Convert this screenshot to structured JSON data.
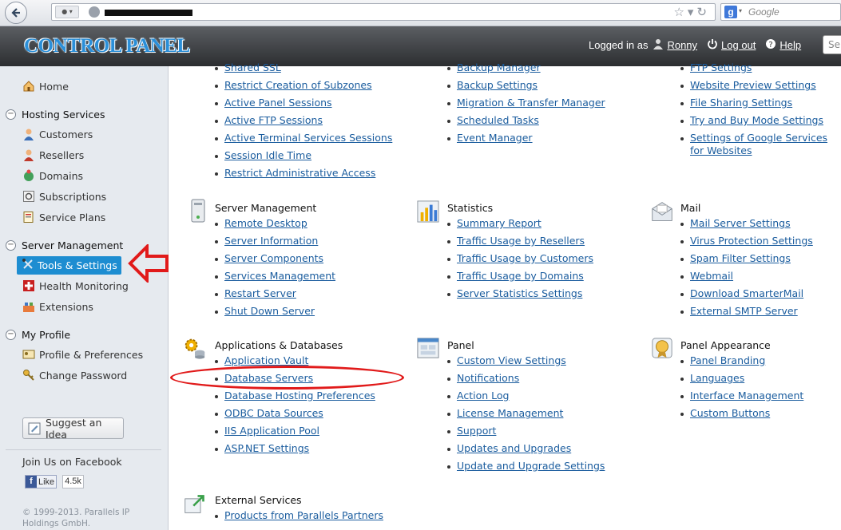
{
  "browser": {
    "search_placeholder": "Google"
  },
  "header": {
    "brand": "CONTROL PANEL",
    "logged_in_as": "Logged in as",
    "user": "Ronny",
    "logout": "Log out",
    "help": "Help",
    "search_placeholder": "Se"
  },
  "sidebar": {
    "home": "Home",
    "hosting_services": "Hosting Services",
    "hosting_items": [
      "Customers",
      "Resellers",
      "Domains",
      "Subscriptions",
      "Service Plans"
    ],
    "server_management": "Server Management",
    "tools_settings": "Tools & Settings",
    "server_items": [
      "Health Monitoring",
      "Extensions"
    ],
    "my_profile": "My Profile",
    "profile_items": [
      "Profile & Preferences",
      "Change Password"
    ],
    "suggest": "Suggest an Idea",
    "facebook_title": "Join Us on Facebook",
    "like": "Like",
    "like_count": "4.5k",
    "copyright": "© 1999-2013. Parallels IP Holdings GmbH."
  },
  "main": {
    "top_col1": [
      "Shared SSL",
      "Restrict Creation of Subzones",
      "Active Panel Sessions",
      "Active FTP Sessions",
      "Active Terminal Services Sessions",
      "Session Idle Time",
      "Restrict Administrative Access"
    ],
    "top_col2": [
      "Backup Manager",
      "Backup Settings",
      "Migration & Transfer Manager",
      "Scheduled Tasks",
      "Event Manager"
    ],
    "top_col3": [
      "FTP Settings",
      "Website Preview Settings",
      "File Sharing Settings",
      "Try and Buy Mode Settings",
      "Settings of Google Services for Websites"
    ],
    "server_management": {
      "title": "Server Management",
      "links": [
        "Remote Desktop",
        "Server Information",
        "Server Components",
        "Services Management",
        "Restart Server",
        "Shut Down Server"
      ]
    },
    "statistics": {
      "title": "Statistics",
      "links": [
        "Summary Report",
        "Traffic Usage by Resellers",
        "Traffic Usage by Customers",
        "Traffic Usage by Domains",
        "Server Statistics Settings"
      ]
    },
    "mail": {
      "title": "Mail",
      "links": [
        "Mail Server Settings",
        "Virus Protection Settings",
        "Spam Filter Settings",
        "Webmail",
        "Download SmarterMail",
        "External SMTP Server"
      ]
    },
    "apps_db": {
      "title": "Applications & Databases",
      "links": [
        "Application Vault",
        "Database Servers",
        "Database Hosting Preferences",
        "ODBC Data Sources",
        "IIS Application Pool",
        "ASP.NET Settings"
      ]
    },
    "panel": {
      "title": "Panel",
      "links": [
        "Custom View Settings",
        "Notifications",
        "Action Log",
        "License Management",
        "Support",
        "Updates and Upgrades",
        "Update and Upgrade Settings"
      ]
    },
    "panel_appearance": {
      "title": "Panel Appearance",
      "links": [
        "Panel Branding",
        "Languages",
        "Interface Management",
        "Custom Buttons"
      ]
    },
    "external": {
      "title": "External Services",
      "links": [
        "Products from Parallels Partners"
      ]
    }
  },
  "colors": {
    "accent": "#1d8dd1",
    "link": "#1a5c9e",
    "annotation": "#e11a1a"
  }
}
